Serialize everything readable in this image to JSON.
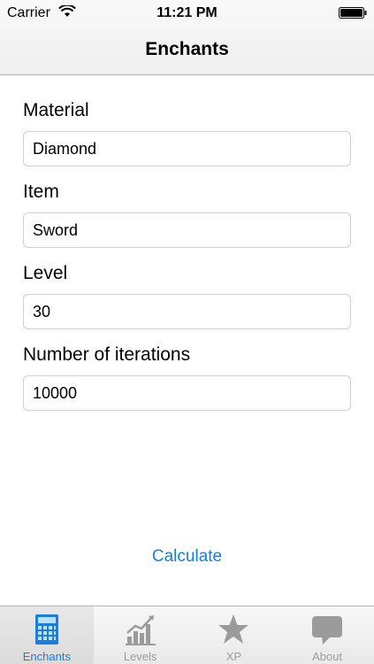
{
  "status_bar": {
    "carrier": "Carrier",
    "time": "11:21 PM"
  },
  "nav": {
    "title": "Enchants"
  },
  "form": {
    "material_label": "Material",
    "material_value": "Diamond",
    "item_label": "Item",
    "item_value": "Sword",
    "level_label": "Level",
    "level_value": "30",
    "iterations_label": "Number of iterations",
    "iterations_value": "10000"
  },
  "calculate_label": "Calculate",
  "tabs": [
    {
      "label": "Enchants",
      "icon": "calculator-icon",
      "active": true
    },
    {
      "label": "Levels",
      "icon": "chart-icon",
      "active": false
    },
    {
      "label": "XP",
      "icon": "star-icon",
      "active": false
    },
    {
      "label": "About",
      "icon": "speech-bubble-icon",
      "active": false
    }
  ],
  "colors": {
    "accent": "#1a7de0",
    "inactive_tab": "#9b9b9b"
  }
}
